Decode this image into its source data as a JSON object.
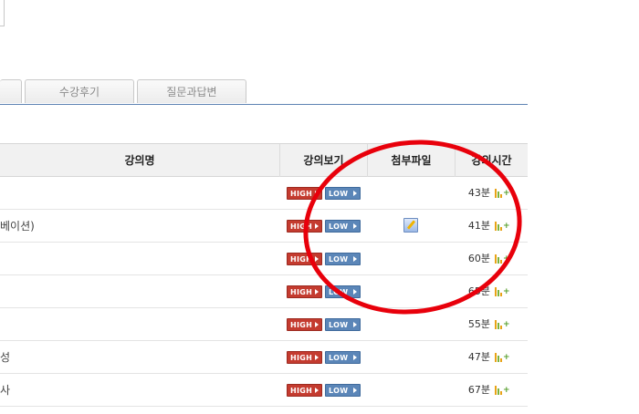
{
  "tabs": [
    {
      "label": ""
    },
    {
      "label": "수강후기"
    },
    {
      "label": "질문과답변"
    }
  ],
  "table": {
    "headers": {
      "title": "강의명",
      "view": "강의보기",
      "attachment": "첨부파일",
      "duration": "강의시간"
    },
    "rows": [
      {
        "title": "",
        "high": "HIGH",
        "low": "LOW",
        "attachment": false,
        "duration": "43분"
      },
      {
        "title": "베이션)",
        "high": "HIGH",
        "low": "LOW",
        "attachment": true,
        "duration": "41분"
      },
      {
        "title": "",
        "high": "HIGH",
        "low": "LOW",
        "attachment": false,
        "duration": "60분"
      },
      {
        "title": "",
        "high": "HIGH",
        "low": "LOW",
        "attachment": false,
        "duration": "65분"
      },
      {
        "title": "",
        "high": "HIGH",
        "low": "LOW",
        "attachment": false,
        "duration": "55분"
      },
      {
        "title": "성",
        "high": "HIGH",
        "low": "LOW",
        "attachment": false,
        "duration": "47분"
      },
      {
        "title": "사",
        "high": "HIGH",
        "low": "LOW",
        "attachment": false,
        "duration": "67분"
      }
    ]
  },
  "annotation": {
    "color": "#e8000b"
  },
  "icons": {
    "attachment": "memo-pencil-icon",
    "duration": "bars-plus-icon"
  }
}
